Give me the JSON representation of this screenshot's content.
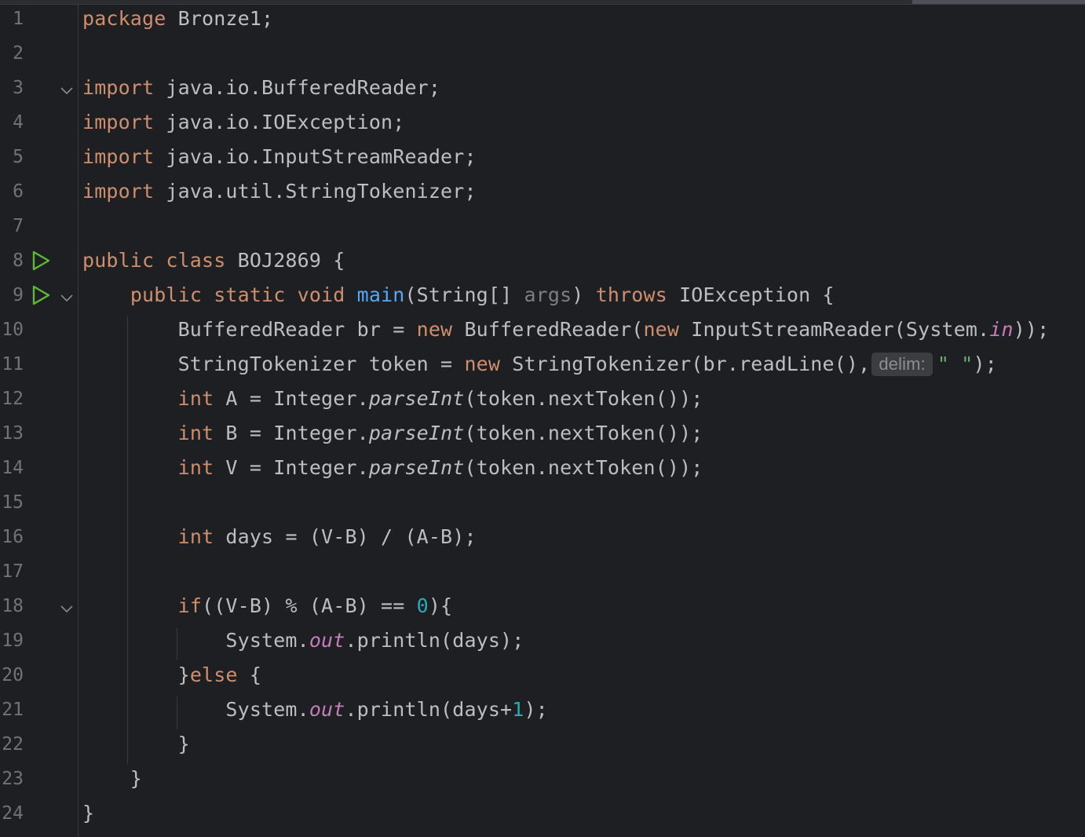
{
  "editor": {
    "language": "Java",
    "lines": [
      {
        "n": "1",
        "tokens": [
          {
            "t": "package",
            "c": "kw"
          },
          {
            "t": " Bronze1;",
            "c": ""
          }
        ]
      },
      {
        "n": "2",
        "tokens": []
      },
      {
        "n": "3",
        "fold": true,
        "tokens": [
          {
            "t": "import",
            "c": "kw"
          },
          {
            "t": " java.io.BufferedReader;",
            "c": ""
          }
        ]
      },
      {
        "n": "4",
        "tokens": [
          {
            "t": "import",
            "c": "kw"
          },
          {
            "t": " java.io.IOException;",
            "c": ""
          }
        ]
      },
      {
        "n": "5",
        "tokens": [
          {
            "t": "import",
            "c": "kw"
          },
          {
            "t": " java.io.InputStreamReader;",
            "c": ""
          }
        ]
      },
      {
        "n": "6",
        "tokens": [
          {
            "t": "import",
            "c": "kw"
          },
          {
            "t": " java.util.StringTokenizer;",
            "c": ""
          }
        ]
      },
      {
        "n": "7",
        "tokens": []
      },
      {
        "n": "8",
        "run": true,
        "tokens": [
          {
            "t": "public class",
            "c": "kw"
          },
          {
            "t": " BOJ2869 {",
            "c": ""
          }
        ]
      },
      {
        "n": "9",
        "run": true,
        "fold": true,
        "tokens": [
          {
            "t": "    ",
            "c": ""
          },
          {
            "t": "public static void",
            "c": "kw"
          },
          {
            "t": " ",
            "c": ""
          },
          {
            "t": "main",
            "c": "fn"
          },
          {
            "t": "(String[] ",
            "c": ""
          },
          {
            "t": "args",
            "c": "param"
          },
          {
            "t": ") ",
            "c": ""
          },
          {
            "t": "throws",
            "c": "kw"
          },
          {
            "t": " IOException {",
            "c": ""
          }
        ]
      },
      {
        "n": "10",
        "tokens": [
          {
            "t": "        BufferedReader br = ",
            "c": ""
          },
          {
            "t": "new",
            "c": "kw"
          },
          {
            "t": " BufferedReader(",
            "c": ""
          },
          {
            "t": "new",
            "c": "kw"
          },
          {
            "t": " InputStreamReader(System.",
            "c": ""
          },
          {
            "t": "in",
            "c": "static"
          },
          {
            "t": "));",
            "c": ""
          }
        ]
      },
      {
        "n": "11",
        "tokens": [
          {
            "t": "        StringTokenizer token = ",
            "c": ""
          },
          {
            "t": "new",
            "c": "kw"
          },
          {
            "t": " StringTokenizer(br.readLine(),",
            "c": ""
          },
          {
            "t": "delim:",
            "c": "hint"
          },
          {
            "t": "\" \"",
            "c": "str"
          },
          {
            "t": ");",
            "c": ""
          }
        ]
      },
      {
        "n": "12",
        "tokens": [
          {
            "t": "        ",
            "c": ""
          },
          {
            "t": "int",
            "c": "kw"
          },
          {
            "t": " A = Integer.",
            "c": ""
          },
          {
            "t": "parseInt",
            "c": "italic-m"
          },
          {
            "t": "(token.nextToken());",
            "c": ""
          }
        ]
      },
      {
        "n": "13",
        "tokens": [
          {
            "t": "        ",
            "c": ""
          },
          {
            "t": "int",
            "c": "kw"
          },
          {
            "t": " B = Integer.",
            "c": ""
          },
          {
            "t": "parseInt",
            "c": "italic-m"
          },
          {
            "t": "(token.nextToken());",
            "c": ""
          }
        ]
      },
      {
        "n": "14",
        "tokens": [
          {
            "t": "        ",
            "c": ""
          },
          {
            "t": "int",
            "c": "kw"
          },
          {
            "t": " V = Integer.",
            "c": ""
          },
          {
            "t": "parseInt",
            "c": "italic-m"
          },
          {
            "t": "(token.nextToken());",
            "c": ""
          }
        ]
      },
      {
        "n": "15",
        "tokens": []
      },
      {
        "n": "16",
        "tokens": [
          {
            "t": "        ",
            "c": ""
          },
          {
            "t": "int",
            "c": "kw"
          },
          {
            "t": " days = (V-B) / (A-B);",
            "c": ""
          }
        ]
      },
      {
        "n": "17",
        "tokens": []
      },
      {
        "n": "18",
        "fold": true,
        "tokens": [
          {
            "t": "        ",
            "c": ""
          },
          {
            "t": "if",
            "c": "kw"
          },
          {
            "t": "((V-B) % (A-B) == ",
            "c": ""
          },
          {
            "t": "0",
            "c": "num"
          },
          {
            "t": "){",
            "c": ""
          }
        ]
      },
      {
        "n": "19",
        "tokens": [
          {
            "t": "            System.",
            "c": ""
          },
          {
            "t": "out",
            "c": "static"
          },
          {
            "t": ".println(days);",
            "c": ""
          }
        ]
      },
      {
        "n": "20",
        "tokens": [
          {
            "t": "        }",
            "c": ""
          },
          {
            "t": "else",
            "c": "kw"
          },
          {
            "t": " {",
            "c": ""
          }
        ]
      },
      {
        "n": "21",
        "tokens": [
          {
            "t": "            System.",
            "c": ""
          },
          {
            "t": "out",
            "c": "static"
          },
          {
            "t": ".println(days+",
            "c": ""
          },
          {
            "t": "1",
            "c": "num"
          },
          {
            "t": ");",
            "c": ""
          }
        ]
      },
      {
        "n": "22",
        "tokens": [
          {
            "t": "        }",
            "c": ""
          }
        ]
      },
      {
        "n": "23",
        "tokens": [
          {
            "t": "    }",
            "c": ""
          }
        ]
      },
      {
        "n": "24",
        "tokens": [
          {
            "t": "}",
            "c": ""
          }
        ]
      }
    ]
  },
  "icons": {
    "run": "run-gutter-icon",
    "fold": "fold-chevron-icon"
  },
  "colors": {
    "background": "#1e1f22",
    "keyword": "#cf8e6d",
    "method_decl": "#56a8f5",
    "number": "#2aacb8",
    "string": "#6aab73",
    "static_field": "#c77dbb",
    "parameter": "#7a7e85",
    "run_icon": "#5fb832"
  }
}
